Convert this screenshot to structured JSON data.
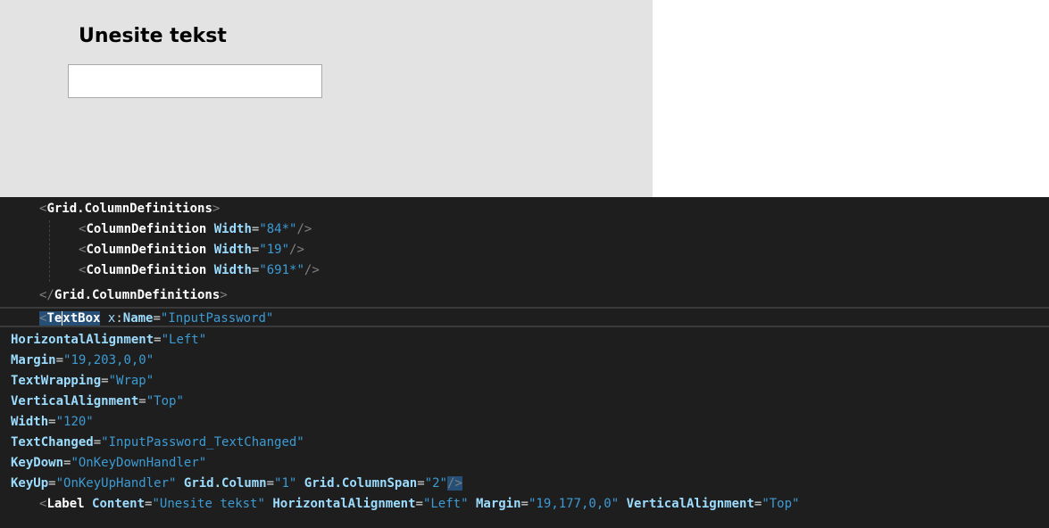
{
  "preview": {
    "label_text": "Unesite tekst",
    "input_value": ""
  },
  "code": {
    "l1": {
      "open": "<",
      "tag": "Grid.ColumnDefinitions",
      "close": ">"
    },
    "l2": {
      "open": "<",
      "tag": "ColumnDefinition",
      "attr": "Width",
      "eq": "=",
      "val": "\"84*\"",
      "close": "/>"
    },
    "l3": {
      "open": "<",
      "tag": "ColumnDefinition",
      "attr": "Width",
      "eq": "=",
      "val": "\"19\"",
      "close": "/>"
    },
    "l4": {
      "open": "<",
      "tag": "ColumnDefinition",
      "attr": "Width",
      "eq": "=",
      "val": "\"691*\"",
      "close": "/>"
    },
    "l5": {
      "open": "</",
      "tag": "Grid.ColumnDefinitions",
      "close": ">"
    },
    "l6": {
      "open": "<",
      "tag_a": "Te",
      "tag_b": "xtBox",
      "ns": "x",
      "colon": ":",
      "attr": "Name",
      "eq": "=",
      "val": "\"InputPassword\""
    },
    "l7": {
      "attr": "HorizontalAlignment",
      "eq": "=",
      "val": "\"Left\""
    },
    "l8": {
      "attr": "Margin",
      "eq": "=",
      "val": "\"19,203,0,0\""
    },
    "l9": {
      "attr": "TextWrapping",
      "eq": "=",
      "val": "\"Wrap\""
    },
    "l10": {
      "attr": "VerticalAlignment",
      "eq": "=",
      "val": "\"Top\""
    },
    "l11": {
      "attr": "Width",
      "eq": "=",
      "val": "\"120\""
    },
    "l12": {
      "attr": "TextChanged",
      "eq": "=",
      "val": "\"InputPassword_TextChanged\""
    },
    "l13": {
      "attr": "KeyDown",
      "eq": "=",
      "val": "\"OnKeyDownHandler\""
    },
    "l14": {
      "attr": "KeyUp",
      "eq": "=",
      "val": "\"OnKeyUpHandler\"",
      "attr2": "Grid.Column",
      "val2": "\"1\"",
      "attr3": "Grid.ColumnSpan",
      "val3": "\"2\"",
      "close": "/>"
    },
    "l15": {
      "open": "<",
      "tag": "Label",
      "attr": "Content",
      "val": "\"Unesite tekst\"",
      "attr2": "HorizontalAlignment",
      "val2": "\"Left\"",
      "attr3": "Margin",
      "val3": "\"19,177,0,0\"",
      "attr4": "VerticalAlignment",
      "val4": "\"Top\"",
      "eq": "="
    }
  }
}
